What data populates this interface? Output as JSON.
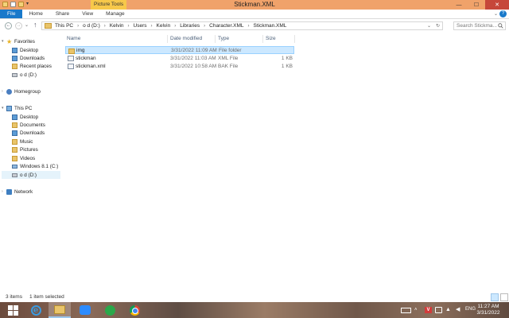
{
  "window": {
    "title": "Stickman.XML",
    "context_tab": "Picture Tools",
    "minimize": "—",
    "maximize": "☐",
    "close": "✕"
  },
  "ribbon": {
    "tabs": [
      {
        "label": "File"
      },
      {
        "label": "Home"
      },
      {
        "label": "Share"
      },
      {
        "label": "View"
      },
      {
        "label": "Manage"
      }
    ],
    "help": "?"
  },
  "address": {
    "breadcrumbs": [
      "This PC",
      "o d (D:)",
      "Kelvin",
      "Users",
      "Kelvin",
      "Libraries",
      "Character.XML",
      "Stickman.XML"
    ],
    "search_placeholder": "Search Stickma..."
  },
  "nav": {
    "favorites": "Favorites",
    "desktop": "Desktop",
    "downloads": "Downloads",
    "recent": "Recent places",
    "od": "o d (D:)",
    "homegroup": "Homegroup",
    "thispc": "This PC",
    "pc_desktop": "Desktop",
    "pc_documents": "Documents",
    "pc_downloads": "Downloads",
    "pc_music": "Music",
    "pc_pictures": "Pictures",
    "pc_videos": "Videos",
    "win81": "Windows 8.1 (C:)",
    "od2": "o d (D:)",
    "network": "Network"
  },
  "columns": {
    "name": "Name",
    "date": "Date modified",
    "type": "Type",
    "size": "Size"
  },
  "files": [
    {
      "name": "img",
      "date": "3/31/2022 11:09 AM",
      "type": "File folder",
      "size": ""
    },
    {
      "name": "stickman",
      "date": "3/31/2022 11:03 AM",
      "type": "XML File",
      "size": "1 KB"
    },
    {
      "name": "stickman.xml",
      "date": "3/31/2022 10:58 AM",
      "type": "BAK File",
      "size": "1 KB"
    }
  ],
  "status": {
    "items": "3 items",
    "selected": "1 item selected"
  },
  "taskbar": {
    "ie_letter": "e",
    "vpn_letter": "V",
    "lang": "ENG",
    "time": "11:27 AM",
    "date": "3/31/2022"
  }
}
